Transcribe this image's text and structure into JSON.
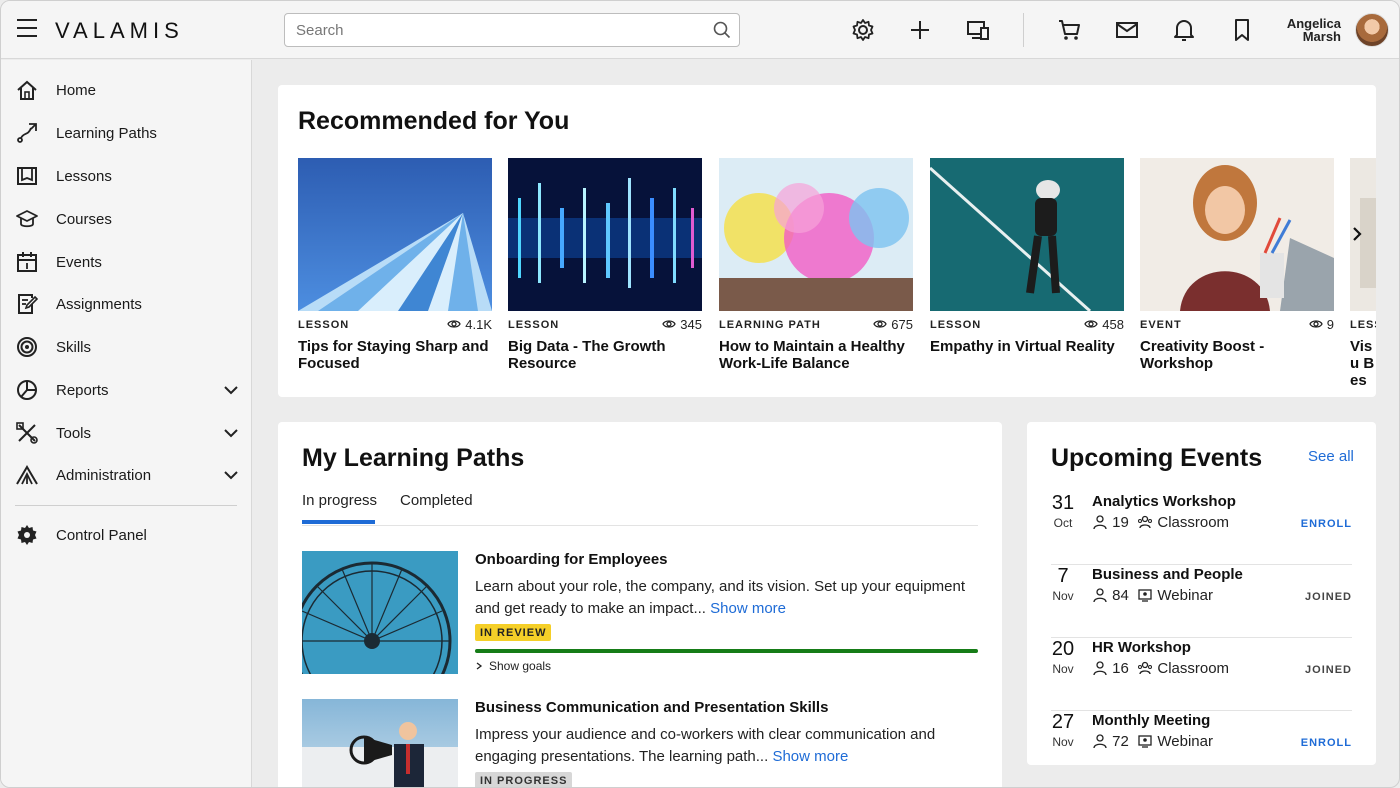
{
  "header": {
    "brand": "VALAMIS",
    "search_placeholder": "Search",
    "user_first": "Angelica",
    "user_last": "Marsh"
  },
  "sidebar": {
    "items": [
      {
        "label": "Home"
      },
      {
        "label": "Learning Paths"
      },
      {
        "label": "Lessons"
      },
      {
        "label": "Courses"
      },
      {
        "label": "Events"
      },
      {
        "label": "Assignments"
      },
      {
        "label": "Skills"
      },
      {
        "label": "Reports"
      },
      {
        "label": "Tools"
      },
      {
        "label": "Administration"
      },
      {
        "label": "Control Panel"
      }
    ]
  },
  "recommended": {
    "title": "Recommended for You",
    "items": [
      {
        "type": "LESSON",
        "views": "4.1K",
        "title": "Tips for Staying Sharp and Focused"
      },
      {
        "type": "LESSON",
        "views": "345",
        "title": "Big Data - The Growth Resource"
      },
      {
        "type": "LEARNING PATH",
        "views": "675",
        "title": "How to Maintain a Healthy Work-Life Balance"
      },
      {
        "type": "LESSON",
        "views": "458",
        "title": "Empathy in Virtual Reality"
      },
      {
        "type": "EVENT",
        "views": "9",
        "title": "Creativity Boost - Workshop"
      },
      {
        "type": "LESS",
        "views": "",
        "title": "Visu Bes"
      }
    ]
  },
  "learning_paths": {
    "title": "My Learning Paths",
    "tabs": [
      {
        "label": "In progress"
      },
      {
        "label": "Completed"
      }
    ],
    "items": [
      {
        "title": "Onboarding for Employees",
        "desc": "Learn about your role, the company, and its vision. Set up your equipment and get ready to make an impact...",
        "show_more": "Show more",
        "status": "IN REVIEW",
        "progress": 1.0,
        "show_goals": "Show goals"
      },
      {
        "title": "Business Communication and Presentation Skills",
        "desc": "Impress your audience and co-workers with clear communication and engaging presentations. The learning path...",
        "show_more": "Show more",
        "status": "IN PROGRESS"
      }
    ]
  },
  "events": {
    "title": "Upcoming Events",
    "see_all": "See all",
    "items": [
      {
        "day": "31",
        "month": "Oct",
        "title": "Analytics Workshop",
        "count": "19",
        "location": "Classroom",
        "action": "ENROLL"
      },
      {
        "day": "7",
        "month": "Nov",
        "title": "Business and People",
        "count": "84",
        "location": "Webinar",
        "action": "JOINED"
      },
      {
        "day": "20",
        "month": "Nov",
        "title": "HR Workshop",
        "count": "16",
        "location": "Classroom",
        "action": "JOINED"
      },
      {
        "day": "27",
        "month": "Nov",
        "title": "Monthly Meeting",
        "count": "72",
        "location": "Webinar",
        "action": "ENROLL"
      }
    ]
  }
}
